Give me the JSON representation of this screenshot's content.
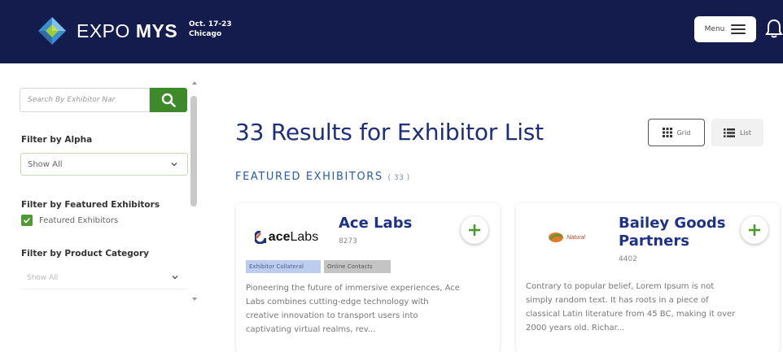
{
  "header": {
    "logo_text_light": "EXPO ",
    "logo_text_bold": "MYS",
    "event_dates": "Oct. 17-23",
    "event_city": "Chicago",
    "menu_label": "Menu",
    "brand_color": "#141b4d"
  },
  "sidebar": {
    "search_placeholder": "Search By Exhibitor Nar",
    "filter_alpha_label": "Filter by Alpha",
    "filter_alpha_value": "Show All",
    "filter_featured_label": "Filter by Featured Exhibitors",
    "featured_checkbox_label": "Featured Exhibitors",
    "featured_checked": true,
    "filter_category_label": "Filter by Product Category",
    "filter_category_value": "Show All"
  },
  "main": {
    "results_title": "33 Results for Exhibitor List",
    "view_grid_label": "Grid",
    "view_list_label": "List",
    "featured_heading": "FEATURED EXHIBITORS",
    "featured_count": "( 33 )"
  },
  "exhibitors": [
    {
      "name": "Ace Labs",
      "booth": "8273",
      "logo_text_bold": "ace",
      "logo_text_light": "Labs",
      "tags": [
        "Exhibitor Collateral",
        "Online Contacts"
      ],
      "description_lines": [
        "Pioneering the future of immersive experiences, Ace",
        "Labs combines cutting-edge technology with",
        "creative innovation to transport users into",
        "captivating virtual realms, rev..."
      ]
    },
    {
      "name_line1": "Bailey Goods",
      "name_line2": "Partners",
      "booth": "4402",
      "logo_text": "Natural",
      "description_lines": [
        "Contrary to popular belief, Lorem Ipsum is not",
        "simply random text. It has roots in a piece of",
        "classical Latin literature from 45 BC, making it over",
        "2000 years old. Richar..."
      ]
    }
  ],
  "colors": {
    "accent_green": "#3e8a2a",
    "title_blue": "#1d2f7a",
    "card_name_blue": "#1d3288"
  }
}
